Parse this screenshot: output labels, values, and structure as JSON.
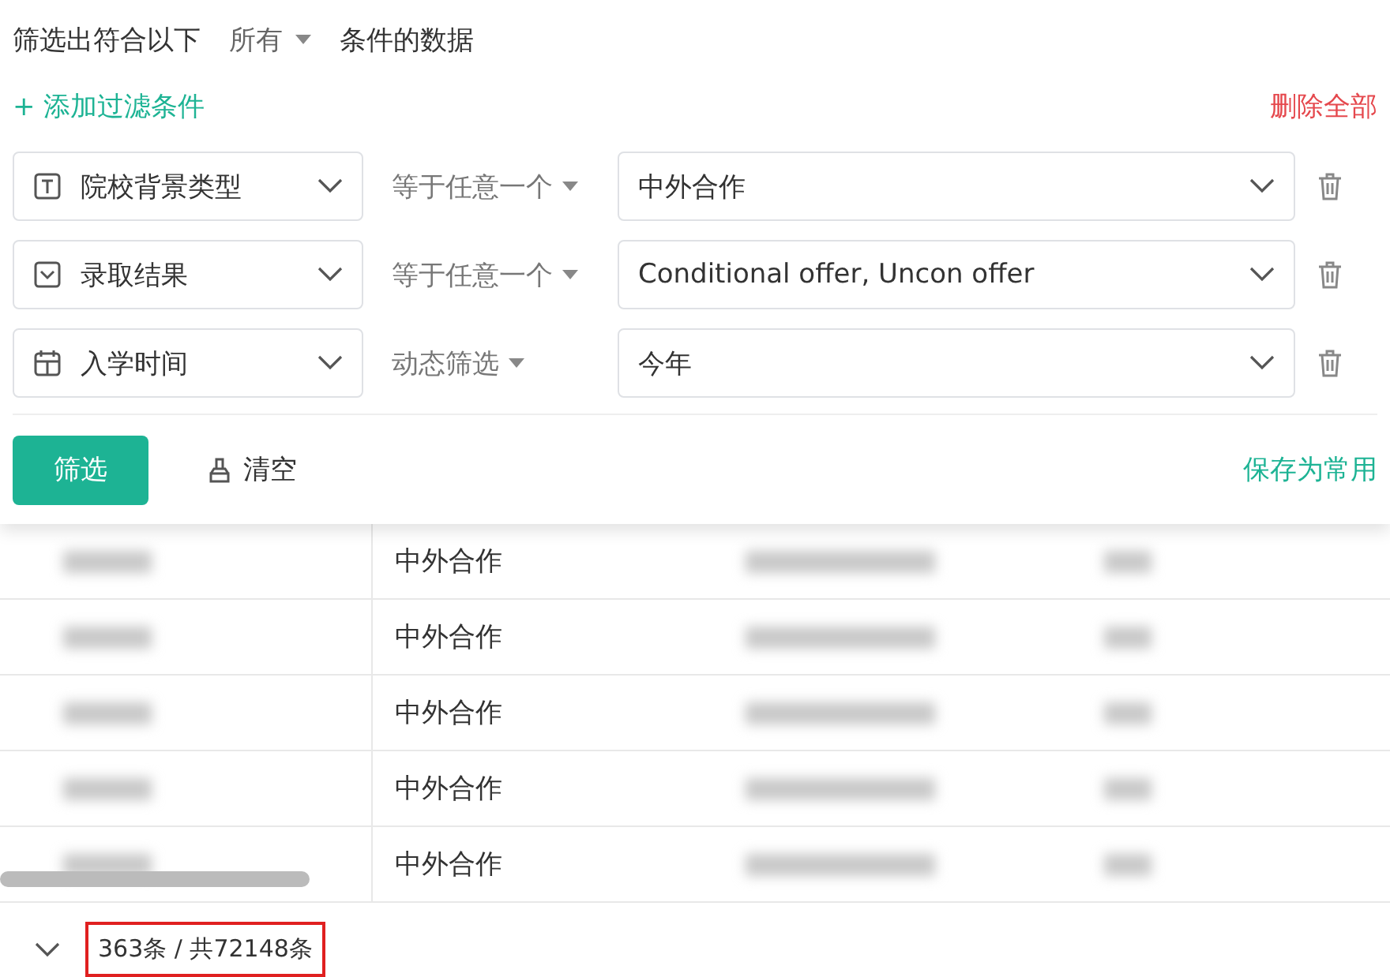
{
  "filter_panel": {
    "heading_before": "筛选出符合以下",
    "match_mode": "所有",
    "heading_after": "条件的数据",
    "add_condition": "+ 添加过滤条件",
    "delete_all": "删除全部",
    "conditions": [
      {
        "field": "院校背景类型",
        "kind": "text",
        "operator": "等于任意一个",
        "value": "中外合作"
      },
      {
        "field": "录取结果",
        "kind": "select",
        "operator": "等于任意一个",
        "value": "Conditional offer, Uncon offer"
      },
      {
        "field": "入学时间",
        "kind": "date",
        "operator": "动态筛选",
        "value": "今年"
      }
    ],
    "filter_button": "筛选",
    "clear_button": "清空",
    "save_button": "保存为常用"
  },
  "table": {
    "rows": [
      {
        "column_2": "中外合作"
      },
      {
        "column_2": "中外合作"
      },
      {
        "column_2": "中外合作"
      },
      {
        "column_2": "中外合作"
      },
      {
        "column_2": "中外合作"
      }
    ]
  },
  "footer": {
    "count": "363条 / 共72148条",
    "highlighted": true
  }
}
